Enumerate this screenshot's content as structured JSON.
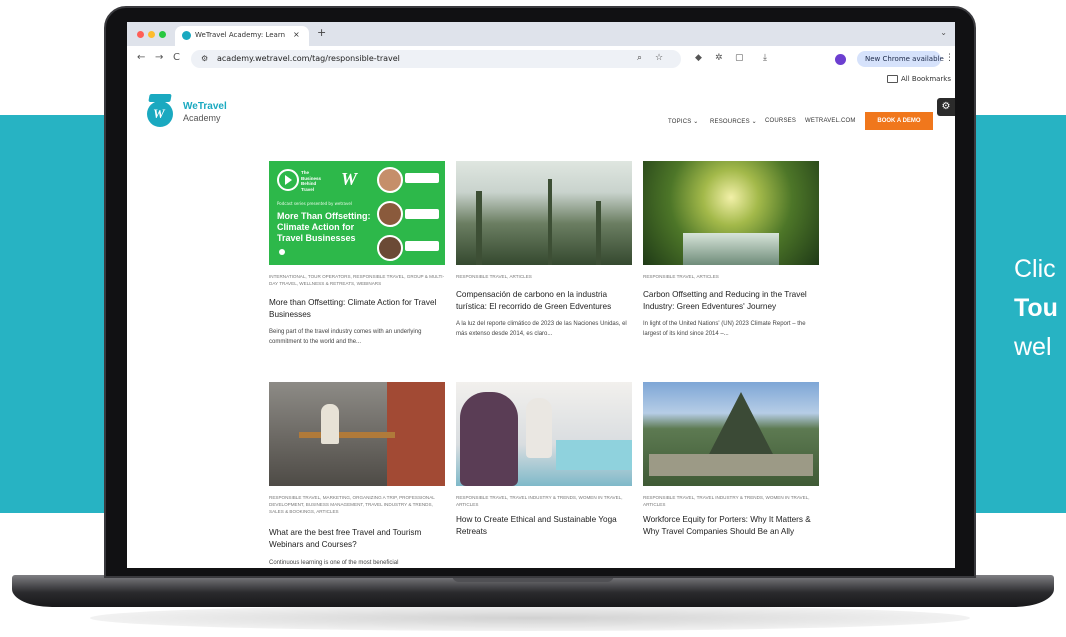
{
  "promo": {
    "line1": "Clic",
    "line2": "Tou",
    "line3": "wel"
  },
  "browser": {
    "tab_title": "WeTravel Academy: Learn fro",
    "tab_close": "×",
    "new_tab": "+",
    "url": "academy.wetravel.com/tag/responsible-travel",
    "update_label": "New Chrome available",
    "all_bookmarks": "All Bookmarks",
    "nav_back": "←",
    "nav_forward": "→",
    "nav_reload": "C"
  },
  "site": {
    "logo_line1": "WeTravel",
    "logo_line2": "Academy",
    "nav": {
      "topics": "TOPICS ⌄",
      "resources": "RESOURCES ⌄",
      "courses": "COURSES",
      "wetravel": "WETRAVEL.COM",
      "demo": "BOOK A DEMO"
    }
  },
  "podcast_thumb": {
    "show": "The\nBusiness\nBehind\nTravel",
    "presented": "Podcast series presented by wetravel",
    "title": "More Than Offsetting: Climate Action for Travel Businesses"
  },
  "cards": [
    {
      "categories": "INTERNATIONAL, TOUR OPERATORS, RESPONSIBLE TRAVEL, GROUP & MULTI-DAY TRAVEL, WELLNESS & RETREATS, WEBINARS",
      "title": "More than Offsetting: Climate Action for Travel Businesses",
      "excerpt": "Being part of the travel industry comes with an underlying commitment to the world and the..."
    },
    {
      "categories": "RESPONSIBLE TRAVEL, ARTICLES",
      "title": "Compensación de carbono en la industria turística: El recorrido de Green Edventures",
      "excerpt": "A la luz del reporte climático de 2023 de las Naciones Unidas, el más extenso desde 2014, es claro..."
    },
    {
      "categories": "RESPONSIBLE TRAVEL, ARTICLES",
      "title": "Carbon Offsetting and Reducing in the Travel Industry: Green Edventures' Journey",
      "excerpt": "In light of the United Nations' (UN) 2023 Climate Report – the largest of its kind since 2014 –..."
    },
    {
      "categories": "RESPONSIBLE TRAVEL, MARKETING, ORGANIZING A TRIP, PROFESSIONAL DEVELOPMENT, BUSINESS MANAGEMENT, TRAVEL INDUSTRY & TRENDS, SALES & BOOKINGS, ARTICLES",
      "title": "What are the best free Travel and Tourism Webinars and Courses?",
      "excerpt": "Continuous learning is one of the most beneficial"
    },
    {
      "categories": "RESPONSIBLE TRAVEL, TRAVEL INDUSTRY & TRENDS, WOMEN IN TRAVEL, ARTICLES",
      "title": "How to Create Ethical and Sustainable Yoga Retreats",
      "excerpt": ""
    },
    {
      "categories": "RESPONSIBLE TRAVEL, TRAVEL INDUSTRY & TRENDS, WOMEN IN TRAVEL, ARTICLES",
      "title": "Workforce Equity for Porters: Why It Matters & Why Travel Companies Should Be an Ally",
      "excerpt": ""
    }
  ],
  "colors": {
    "teal": "#27b3c3",
    "brand": "#1aa9c0",
    "demo_button": "#f0771c",
    "podcast_green": "#2db84a"
  },
  "icons": [
    "search-icon",
    "star-icon",
    "extension-icon",
    "puzzle-icon",
    "download-icon",
    "folder-icon",
    "hubspot-icon",
    "kebab-menu-icon"
  ]
}
